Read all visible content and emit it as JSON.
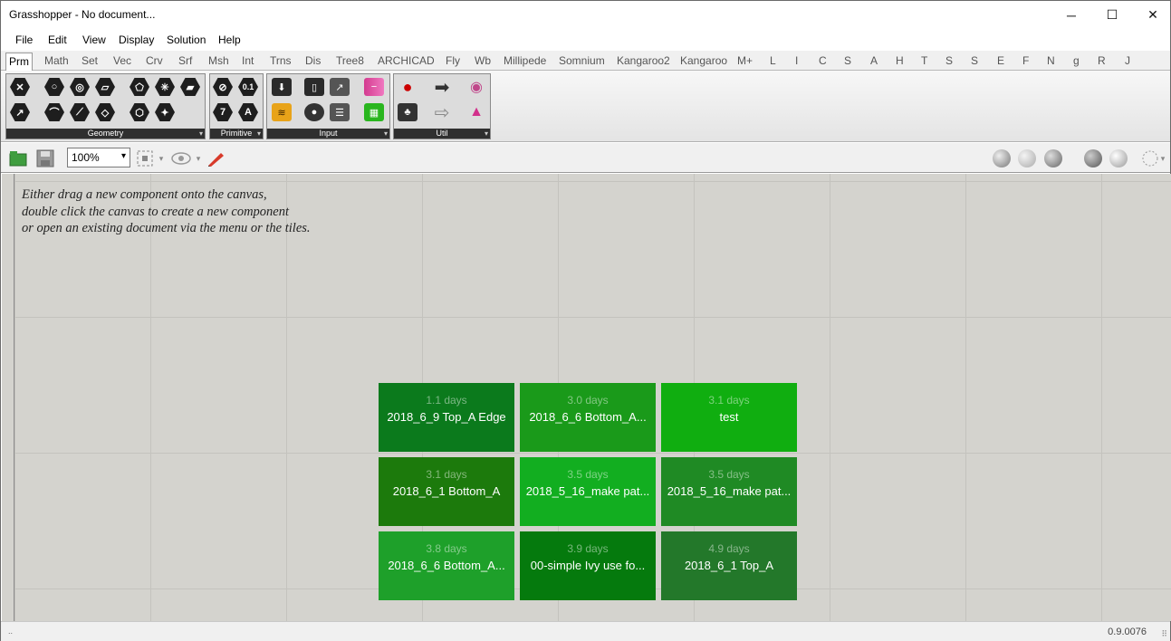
{
  "window": {
    "title": "Grasshopper - No document...",
    "minimize": "─",
    "maximize": "☐",
    "close": "✕"
  },
  "menu": [
    "File",
    "Edit",
    "View",
    "Display",
    "Solution",
    "Help"
  ],
  "tabs": [
    "Prm",
    "Math",
    "Set",
    "Vec",
    "Crv",
    "Srf",
    "Msh",
    "Int",
    "Trns",
    "Dis",
    "Tree8",
    "ARCHICAD",
    "Fly",
    "Wb",
    "Millipede",
    "Somnium",
    "Kangaroo2",
    "Kangaroo",
    "M+",
    "L",
    "I",
    "C",
    "S",
    "A",
    "H",
    "T",
    "S",
    "S",
    "E",
    "F",
    "N",
    "g",
    "R",
    "J"
  ],
  "active_tab": "Prm",
  "ribbon": {
    "groups": [
      {
        "label": "Geometry",
        "expand": "▾"
      },
      {
        "label": "Primitive",
        "expand": "▾"
      },
      {
        "label": "Input",
        "expand": "▾"
      },
      {
        "label": "Util",
        "expand": "▾"
      }
    ],
    "primitive_icons": {
      "number": "0.1",
      "integer": "7",
      "text": "A"
    }
  },
  "toolbar": {
    "zoom": "100%",
    "zoom_arrow": "▾"
  },
  "canvas": {
    "hint_lines": [
      "Either drag a new component onto the canvas,",
      "double click the canvas to create a new component",
      "or open an existing document via the menu or the tiles."
    ]
  },
  "tiles": [
    {
      "age": "1.1 days",
      "name": "2018_6_9 Top_A  Edge",
      "color": "#0b7a1c"
    },
    {
      "age": "3.0 days",
      "name": "2018_6_6  Bottom_A...",
      "color": "#1a9a1a"
    },
    {
      "age": "3.1 days",
      "name": "test",
      "color": "#10ae10"
    },
    {
      "age": "3.1 days",
      "name": "2018_6_1 Bottom_A",
      "color": "#1c7a0c"
    },
    {
      "age": "3.5 days",
      "name": "2018_5_16_make  pat...",
      "color": "#12ae20"
    },
    {
      "age": "3.5 days",
      "name": "2018_5_16_make  pat...",
      "color": "#1f8a24"
    },
    {
      "age": "3.8 days",
      "name": "2018_6_6  Bottom_A...",
      "color": "#1ea02a"
    },
    {
      "age": "3.9 days",
      "name": "00-simple  Ivy  use  fo...",
      "color": "#057a0d"
    },
    {
      "age": "4.9 days",
      "name": "2018_6_1 Top_A",
      "color": "#23782a"
    }
  ],
  "status": {
    "version": "0.9.0076",
    "left": "..",
    "grip": "⠿"
  }
}
